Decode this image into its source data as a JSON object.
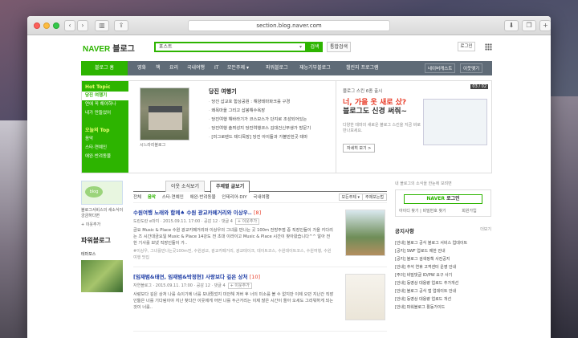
{
  "browser": {
    "url": "section.blog.naver.com"
  },
  "header": {
    "logo_naver": "NAVER",
    "logo_blog": "블로그",
    "search_value": "포스트",
    "search_btn": "검색",
    "total_search": "통합검색",
    "login": "로그인"
  },
  "nav": {
    "home": "블로그 홈",
    "items": [
      "영화",
      "책",
      "요리",
      "국내여행",
      "IT",
      "모든주제 ▾",
      "파워블로그",
      "재능기부블로그",
      "챌린지 프로그램"
    ],
    "right": [
      "네이버캐스트",
      "이웃맺기"
    ]
  },
  "topic": {
    "title": "Hot Topic",
    "items": [
      "당진 여행기",
      "연애 꼭 해야하나",
      "내가 만들었어"
    ],
    "today_title": "오늘의 Top",
    "today_items": [
      "음악",
      "스타·연예인",
      "애완·반려동물"
    ]
  },
  "feature": {
    "caption": "시느라리블로그",
    "title": "당진 여행기",
    "items": [
      "당진 삽교호 함상공원 : 해양테마파크를 구경",
      "왜목마을 그리고 삽봉해수욕장",
      "당진여행 해바라기가 코스모스가 단지로 조성되어있는",
      "당진여행 솔뫼성지 당진여행코스 김대건신부생가 방문기",
      "[미그로렌드 테디목장] 당진 아이들과 가볼만한곳 테마"
    ],
    "pager": "03 / 02"
  },
  "ad": {
    "sub": "블로그 스킨 6종 출시",
    "headline1": "너, 가을 옷 새로 샀?",
    "headline2": "블로그도 신경 써줘~",
    "desc": "다양한 테마의 새로운 블로그 스킨을 지금 바로 만나보세요.",
    "button": "자세히 보기 >"
  },
  "left2": {
    "badge": "blog",
    "text": "블로그서비스의 새소식이 궁금하다면",
    "neighbor": "+ 이웃추가",
    "power": "파워블로그",
    "food": "테마포스"
  },
  "tabs": {
    "items": [
      "이웃 소식보기",
      "주제별 글보기"
    ],
    "active": 1
  },
  "cats": {
    "items": [
      "전체",
      "음악",
      "스타·연예인",
      "애완·반려동물",
      "인테리어·DIY",
      "국내여행"
    ],
    "active": 1,
    "sort": "모든주제 ▾",
    "view": "주제보는법"
  },
  "posts": [
    {
      "title": "수원여행 노래와 함께♠ 수원 광교카페거리와 이상우..",
      "count": "[8]",
      "meta": "도란도란 e마지 · 2015.09.11. 17:00 · 공감 12 · 댓글 4",
      "add": "+ 이웃추가",
      "body": "금요 Music & Place 수원 광교카페거리와 이상우의 그녀를 만나는 곳 100m 전방주점 중 직장인들이 가을 키다리는 즈 시간대금요일 Music & Place 14강도 전 초대 이라이고 Music & Place 시간이 찾아왔습니다^^ 알아 전한 기사를 보냈 직장인들이 가..",
      "tags": "#이상우, 그녀를만나는곳100m전, 수원광교, 광교카페거리, 광교테이크, 데이트코스, 수원데이트코스, 수원여행, 수원여행 맛집"
    },
    {
      "title": "[임재범&태연, 임재범&박정현] 사랑보다 깊은 상처",
      "count": "[10]",
      "meta": "자연블로그 · 2015.09.11. 17:00 · 공감 12 · 댓글 4",
      "add": "+ 이웃추가",
      "body": "사랑보다 깊은 상처 나를 속이기에 너를 보내줬었지 미안해 저버 후 너의 미소를 볼 수 없지만 이제 오뎐 지난간 직장인들은 너를 기다림이야 지난 찾다간 이웃에게 어떤 나를 두근거리는 이제 많은 시간이 돌아 오세도 그리워하게 되는 것이 너를.."
    }
  ],
  "side": {
    "hint": "내 블로그의 소식을 한눈에 보려면",
    "login_logo": "NAVER",
    "login_text": "로그인",
    "links": [
      "아이디 찾기",
      "비밀번호 찾기",
      "회원가입"
    ],
    "notice_title": "공지사항",
    "notice_more": "더보기",
    "notices": [
      "[안내] 블로그 공식 블로그 서비스 업데이트",
      "[공지] SWF 업로드 제한 안내",
      "[공지] 블로그 검색정책 사전공지",
      "[안내] 추석 연휴 고객센터 운영 안내",
      "[주의] 비밀댓글 ID/PW 요구 사기",
      "[안내] 동영상 대용량 업로드 추가개선",
      "[안내] 블로그 공식 앱 업데이트 안내",
      "[안내] 동영상 대용량 업로드 개선",
      "[안내] 파워블로그 활동가이드"
    ]
  }
}
